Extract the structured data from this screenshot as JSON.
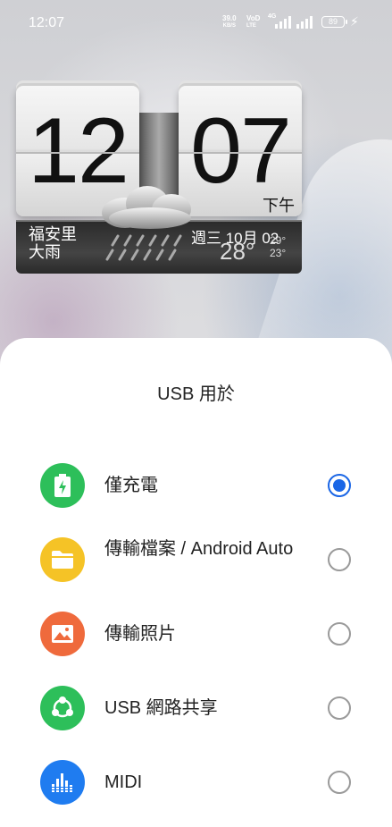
{
  "status_bar": {
    "time": "12:07",
    "net_speed_value": "39.0",
    "net_speed_unit": "KB/S",
    "volte_top": "VoD",
    "volte_bottom": "LTE",
    "network": "4G",
    "battery": "89",
    "charging_icon": "bolt-icon"
  },
  "clock_widget": {
    "hour": "12",
    "minute": "07",
    "ampm": "下午",
    "location": "福安里",
    "condition": "大雨",
    "date": "週三 10月 02",
    "temperature": "28°",
    "high": "29°",
    "low": "23°",
    "weather_icon": "rain-cloud-icon"
  },
  "usb_sheet": {
    "title": "USB 用於",
    "options": [
      {
        "label": "僅充電",
        "icon": "battery-charging-icon",
        "color": "#2dbf5a",
        "selected": true
      },
      {
        "label": "傳輸檔案 / Android Auto",
        "icon": "folder-icon",
        "color": "#f5c326",
        "selected": false
      },
      {
        "label": "傳輸照片",
        "icon": "photo-icon",
        "color": "#ef6a3c",
        "selected": false
      },
      {
        "label": "USB 網路共享",
        "icon": "share-network-icon",
        "color": "#2dbf5a",
        "selected": false
      },
      {
        "label": "MIDI",
        "icon": "equalizer-icon",
        "color": "#1f7cf0",
        "selected": false
      }
    ]
  },
  "colors": {
    "accent": "#1a66e6"
  }
}
